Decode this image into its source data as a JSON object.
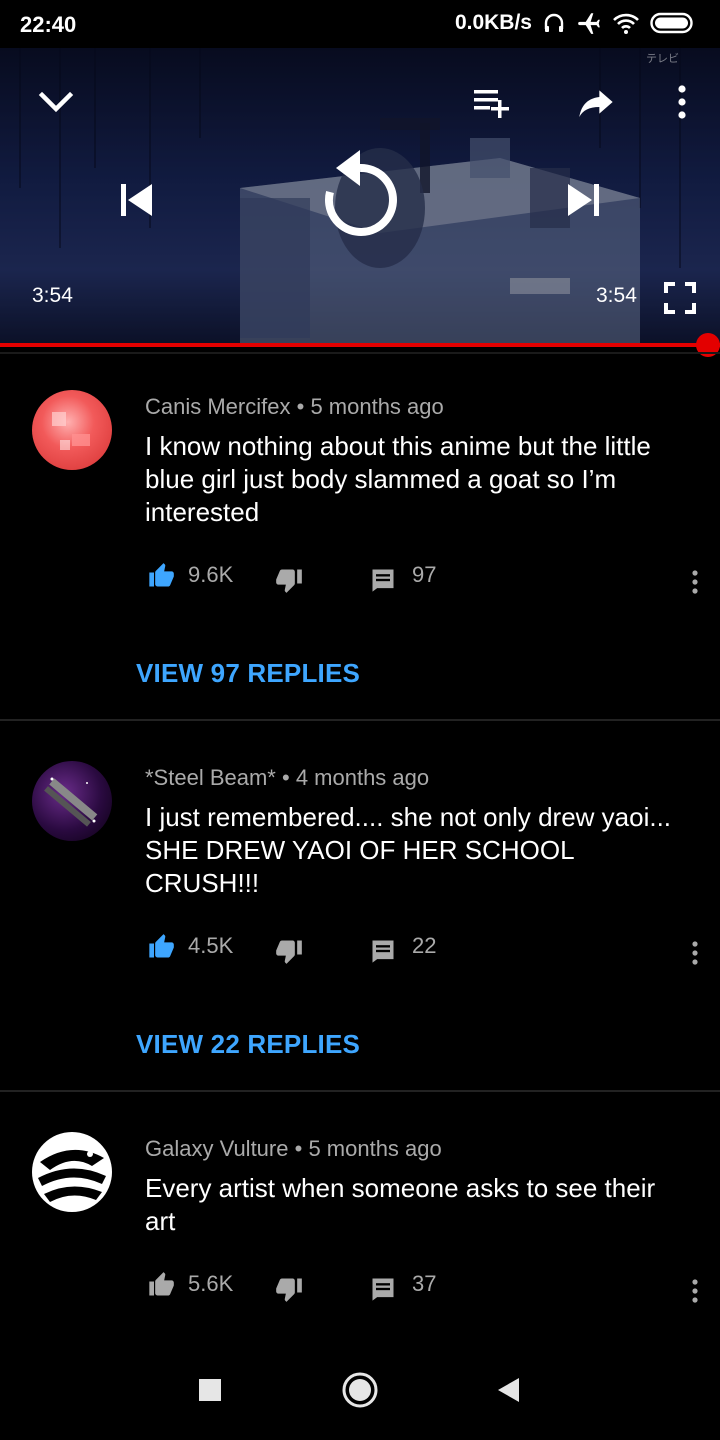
{
  "status_bar": {
    "time": "22:40",
    "network_speed": "0.0KB/s",
    "icons": [
      "headphones-icon",
      "airplane-mode-icon",
      "wifi-icon",
      "battery-icon"
    ]
  },
  "player": {
    "watermark": "テレビ",
    "current_time": "3:54",
    "duration": "3:54",
    "progress": 1.0,
    "accent_color": "#e30000",
    "icons": [
      "collapse-chevron-icon",
      "add-to-queue-icon",
      "share-icon",
      "more-vert-icon",
      "previous-icon",
      "replay-icon",
      "next-icon",
      "fullscreen-icon"
    ]
  },
  "comments": [
    {
      "author": "Canis Mercifex",
      "age": "5 months ago",
      "text": "I know nothing about this anime but the little blue girl just body slammed a goat so I’m interested",
      "likes": "9.6K",
      "replies": "97",
      "liked": true,
      "view_replies_label": "VIEW 97 REPLIES"
    },
    {
      "author": "*Steel Beam*",
      "age": "4 months ago",
      "text": "I just remembered.... she not only drew yaoi... SHE DREW YAOI OF HER SCHOOL CRUSH!!!",
      "likes": "4.5K",
      "replies": "22",
      "liked": true,
      "view_replies_label": "VIEW 22 REPLIES"
    },
    {
      "author": "Galaxy Vulture",
      "age": "5 months ago",
      "text": "Every artist when someone asks to see their art",
      "likes": "5.6K",
      "replies": "37",
      "liked": false
    }
  ],
  "colors": {
    "like_active": "#3ea6ff",
    "link": "#3ea6ff",
    "secondary_text": "#aaaaaa",
    "background": "#000000"
  },
  "nav": {
    "icons": [
      "recents-square-icon",
      "home-circle-icon",
      "back-triangle-icon"
    ]
  }
}
